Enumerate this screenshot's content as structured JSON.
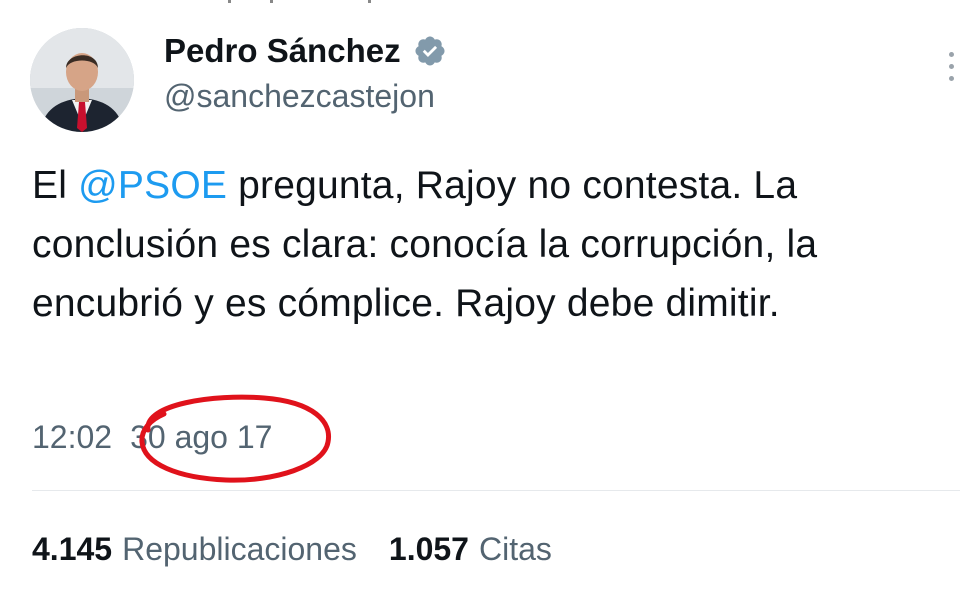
{
  "author": {
    "display_name": "Pedro Sánchez",
    "handle": "@sanchezcastejon",
    "verified_icon": "verified-badge-icon",
    "verified_color": "#829aab"
  },
  "tweet": {
    "text_before_mention": "El ",
    "mention": "@PSOE",
    "text_after_mention": " pregunta, Rajoy no contesta. La conclusión es clara: conocía la corrupción, la encubrió y es cómplice. Rajoy debe dimitir.",
    "time": "12:02",
    "date": "30 ago 17"
  },
  "stats": {
    "reposts_count": "4.145",
    "reposts_label": "Republicaciones",
    "quotes_count": "1.057",
    "quotes_label": "Citas"
  },
  "colors": {
    "mention": "#1d9bf0",
    "secondary_text": "#536471",
    "annotation_circle": "#e0121b"
  }
}
